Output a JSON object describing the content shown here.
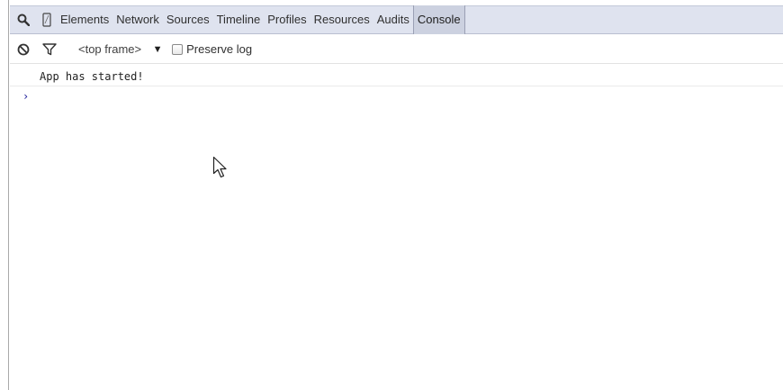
{
  "devtools": {
    "tabs": [
      {
        "label": "Elements"
      },
      {
        "label": "Network"
      },
      {
        "label": "Sources"
      },
      {
        "label": "Timeline"
      },
      {
        "label": "Profiles"
      },
      {
        "label": "Resources"
      },
      {
        "label": "Audits"
      },
      {
        "label": "Console",
        "active": true
      }
    ],
    "icons": {
      "search": "search-icon",
      "device": "device-mode-icon"
    }
  },
  "toolbar": {
    "clear_icon": "clear-console-icon",
    "filter_icon": "filter-icon",
    "frame_select": "<top frame>",
    "dropdown_arrow": "▼",
    "preserve_log_label": "Preserve log",
    "preserve_log_checked": false
  },
  "console": {
    "messages": [
      {
        "text": "App has started!"
      }
    ],
    "prompt": "›"
  },
  "colors": {
    "tabbar_bg": "#dfe3ef",
    "active_tab_bg": "#ccd1e0",
    "prompt": "#1a1a9a"
  }
}
